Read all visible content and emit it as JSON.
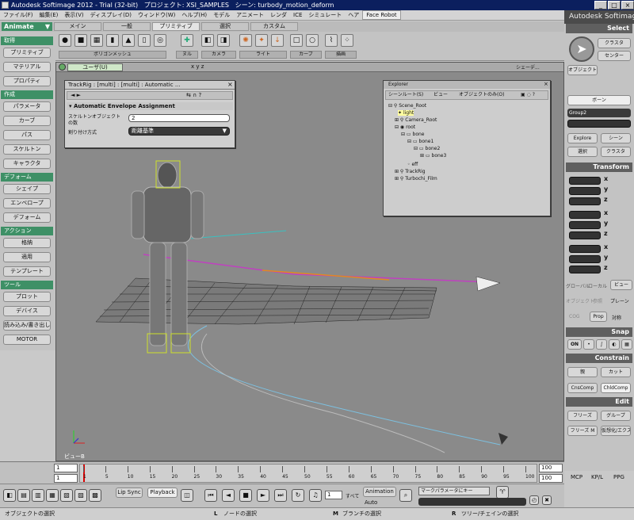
{
  "window": {
    "app": "Autodesk Softimage 2012",
    "trial": "Trial (32-bit)",
    "project_label": "プロジェクト:",
    "project": "XSI_SAMPLES",
    "scene_label": "シーン:",
    "scene": "turbody_motion_deform",
    "brand": "Autodesk Softimage"
  },
  "menu": [
    "ファイル(F)",
    "編集(E)",
    "表示(V)",
    "ディスプレイ(D)",
    "ウィンドウ(W)",
    "ヘルプ(H)",
    "モデル",
    "アニメート",
    "レンダ",
    "ICE",
    "シミュレート",
    "ヘア",
    "Face Robot"
  ],
  "mode": "Animate",
  "tabs": [
    {
      "label": "メイン"
    },
    {
      "label": "一般"
    },
    {
      "label": "プリミティブ"
    },
    {
      "label": "選択"
    },
    {
      "label": "カスタム"
    }
  ],
  "toolbar": {
    "groups": [
      "ポリゴンメッシュ",
      "ヌル",
      "カメラ",
      "ライト",
      "カーブ",
      "描画"
    ]
  },
  "left": {
    "sections": [
      {
        "title": "取得",
        "items": [
          "プリミティブ",
          "マテリアル",
          "プロパティ"
        ]
      },
      {
        "title": "作成",
        "items": [
          "パラメータ",
          "カーブ",
          "パス",
          "スケルトン",
          "キャラクタ"
        ]
      },
      {
        "title": "デフォーム",
        "items": [
          "シェイプ",
          "エンベロープ",
          "デフォーム"
        ]
      },
      {
        "title": "アクション",
        "items": [
          "格納",
          "適用",
          "テンプレート"
        ]
      },
      {
        "title": "ツール",
        "items": [
          "プロット",
          "デバイス",
          "読み込み/書き出し",
          "MOTOR"
        ]
      }
    ]
  },
  "viewport": {
    "camera": "ユーザ(U)",
    "axes": "x y z",
    "frame_tag": "ビューB",
    "corner": "シェーデ..."
  },
  "trackrig": {
    "title": "TrackRig : [multi] : [multi] : Automatic ...",
    "section": "Automatic Envelope Assignment",
    "skeleton_label": "スケルトンオブジェクトの数",
    "skeleton_value": "2",
    "assign_label": "割り付け方式",
    "assign_value": "距離基準"
  },
  "explorer": {
    "title": "Explorer",
    "tab_scene": "シーンルート(S)",
    "tab_view": "ビュー",
    "tab_obj": "オブジェクトのみ(O)",
    "nodes": [
      "Scene_Root",
      "light",
      "Camera_Root",
      "root",
      "bone",
      "bone1",
      "bone2",
      "bone3",
      "eff",
      "TrackRig",
      "Turbochi_Film"
    ]
  },
  "right": {
    "select": {
      "title": "Select",
      "buttons": [
        "クラスタ",
        "センター",
        "オブジェクト",
        "ボーン"
      ],
      "group": "Group2",
      "explore": "Explore",
      "scene": "シーン",
      "select_btn": "選択",
      "cluster": "クラスタ"
    },
    "transform": {
      "title": "Transform",
      "axes": [
        "x",
        "y",
        "z"
      ],
      "modes": [
        "グローバル",
        "ローカル",
        "ビュー",
        "オブジェクト",
        "参照",
        "プレーン",
        "COG",
        "Prop",
        "対称"
      ]
    },
    "snap": {
      "title": "Snap",
      "on": "ON"
    },
    "constrain": {
      "title": "Constrain",
      "buttons": [
        "親",
        "カット",
        "CnsComp",
        "ChldComp"
      ]
    },
    "edit": {
      "title": "Edit",
      "buttons": [
        "フリーズ",
        "グループ",
        "フリーズ M",
        "仮想化/エクス"
      ]
    },
    "bottom_tabs": [
      "MCP",
      "KP/L",
      "PPG"
    ]
  },
  "timeline": {
    "start": "1",
    "end": "100",
    "current": "1",
    "ticks": [
      "1",
      "5",
      "10",
      "15",
      "20",
      "25",
      "30",
      "35",
      "40",
      "45",
      "50",
      "55",
      "60",
      "65",
      "70",
      "75",
      "80",
      "85",
      "90",
      "95",
      "100"
    ],
    "end_field": "100",
    "end_field2": "100"
  },
  "playbar": {
    "lipsync": "Lip Sync",
    "playback": "Playback",
    "frame": "1",
    "all": "すべて",
    "animation": "Animation",
    "auto": "Auto",
    "param_placeholder": "マークパラメータにキー"
  },
  "status": {
    "left": "オブジェクトの選択",
    "mid": "ノードの選択",
    "mid2": "ブランチの選択",
    "right": "ツリー/チェインの選択",
    "key_l": "L",
    "key_m": "M",
    "key_r": "R"
  }
}
